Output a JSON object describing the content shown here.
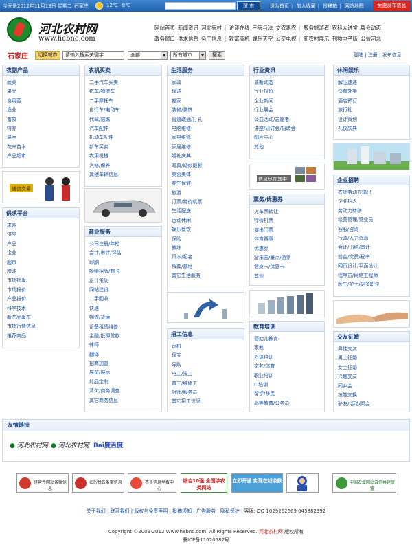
{
  "topbar": {
    "date": "今天是2012年11月13日 星期二",
    "city": "石家庄",
    "temperature": "12℃~0℃",
    "search_button": "搜 索",
    "links": [
      "设为首页",
      "加入收藏",
      "投稿箱",
      "网站地图"
    ],
    "free_publish": "免费发布信息"
  },
  "header": {
    "site_name": "河北农村网",
    "site_url": "www.hebnc.com",
    "nav_row1": [
      "网站首页",
      "新闻资讯",
      "河北农村",
      "|",
      "访谈在线",
      "三农与法",
      "支农惠农",
      "|",
      "服务旅游者",
      "农科大讲堂",
      "展会动态"
    ],
    "nav_row2": [
      "政务窗口",
      "供求信息",
      "务工信息",
      "|",
      "致富商机",
      "娱乐天空",
      "公交电视",
      "|",
      "新农村展示",
      "刊物电子版",
      "公益河北"
    ]
  },
  "citybar": {
    "city": "石家庄",
    "switch_label": "切换城市",
    "search_value": "请输入搜索关键字",
    "category_select": "全部",
    "city_select": "所有城市",
    "search_button": "搜索",
    "right_links": [
      "登陆",
      "注册",
      "发布信息"
    ]
  },
  "boxes": {
    "agri": {
      "title": "农副产品",
      "items": [
        "蔬菜",
        "果品",
        "食用菌",
        "渔业",
        "畜牧",
        "特养",
        "温室",
        "花卉苗木",
        "产品超市"
      ]
    },
    "machinery": {
      "title": "农机买卖",
      "items": [
        "二手汽车买卖",
        "挤车/物流车",
        "二手摩托车",
        "自行车/电动车",
        "代驾/陪练",
        "汽车配件",
        "机动车配件",
        "新车买卖",
        "农用机械",
        "汽修/保养",
        "其他车辆信息"
      ]
    },
    "life": {
      "title": "生活服务",
      "items": [
        "家政",
        "保洁",
        "搬家",
        "装修/装饰",
        "管道疏通/打孔",
        "电脑维修",
        "家电维修",
        "家居维修",
        "婚礼庆典",
        "写真/婚纱摄影",
        "美容美体",
        "养生保健",
        "旅游",
        "订票/特价机票",
        "生活配送",
        "运动休闲",
        "娱乐餐饮",
        "保险",
        "教练",
        "风水/起名",
        "殡葬/墓地",
        "其它生活服务"
      ]
    },
    "industry": {
      "title": "行业资讯",
      "items": [
        "最新动态",
        "行业报价",
        "企业新闻",
        "行业展会",
        "公益活动/志愿者",
        "讲座/研讨会/招聘会",
        "图片中心",
        "其他"
      ]
    },
    "leisure": {
      "title": "休闲娱乐",
      "items": [
        "解压速递",
        "快餐外卖",
        "酒店预订",
        "旅行社",
        "设计策划",
        "礼仪庆典"
      ]
    },
    "supply": {
      "title": "供求平台",
      "items": [
        "求购",
        "供应",
        "产品",
        "企业",
        "超市",
        "粮油",
        "市场批发",
        "市场报价",
        "产品报价",
        "科学技术",
        "新产品发布",
        "市场行情信息",
        "推荐商品"
      ]
    },
    "business": {
      "title": "商业服务",
      "items": [
        "公司注册/年检",
        "会计/审计/评估",
        "印刷",
        "喷绘招牌/制卡",
        "设计策划",
        "网站建设",
        "二手回收",
        "快递",
        "物流/货运",
        "设备租赁维修",
        "金融/抵押贷款",
        "律师",
        "翻译",
        "招商加盟",
        "展览/展示",
        "礼品定制",
        "清欠/商务调查",
        "其它商务信息"
      ]
    },
    "recruit": {
      "title": "招工信息",
      "items": [
        "司机",
        "保安",
        "导购",
        "电工/技工",
        "普工/维修工",
        "厨师/服务员",
        "其它招工信息"
      ]
    },
    "tickets": {
      "title": "票务/优惠券",
      "items": [
        "火车票转让",
        "特价机票",
        "演出门票",
        "体育赛事",
        "优惠券",
        "游乐园/景点/游票",
        "健身卡/优惠卡",
        "其他"
      ]
    },
    "jobs": {
      "title": "企业招聘",
      "items": [
        "农场劳动力输出",
        "企业招人",
        "劳动力转移",
        "经营管理/营业员",
        "客服/咨询",
        "行政/人力资源",
        "会计/出纳/审计",
        "前台/文员/秘书",
        "网页设计/平面设计",
        "程序员/网络工程师",
        "医生/护士/更多职位"
      ]
    },
    "education": {
      "title": "教育培训",
      "items": [
        "婴幼儿教育",
        "家教",
        "外语培训",
        "文艺/体育",
        "职业培训",
        "IT培训",
        "留学/移民",
        "高等教育/公务员"
      ]
    },
    "dating": {
      "title": "交友征婚",
      "items": [
        "异性交友",
        "男士征婚",
        "女士征婚",
        "兴趣交友",
        "同乡会",
        "技能交换",
        "驴友/活动/聚会"
      ]
    }
  },
  "picture_captions": {
    "machinery_ad": "",
    "tickets_ad": "信息尽在其中",
    "agri_ad": "诚信交易"
  },
  "friends": {
    "title": "友情链接",
    "logos": [
      "河北农村网",
      "河北农村网",
      "Bai度百度"
    ]
  },
  "certs": [
    "经营性网站备案信息",
    "ICP/税名备案信息",
    "不良信息举报中心",
    "综合10强 全国涉农类网站",
    "立即开通 实现在线收款",
    "",
    "中国农业网站诚信共建联盟"
  ],
  "footer": {
    "links": [
      "关于我们",
      "联系我们",
      "版权与免责声明",
      "投稿须知",
      "广告服务",
      "隐私保护",
      "客服: QQ 1029262669 643882992"
    ],
    "copyright_prefix": "Copyright ©2009-2012 Www.hebnc.com. All Rights Reserved. ",
    "copyright_site": "河北农村网",
    "copyright_suffix": " 版权所有",
    "icp": "冀ICP备11020587号"
  },
  "colors": {
    "topbar": "#2a6fc0",
    "accent_red": "#c81e1e",
    "link_blue": "#1a4f9a",
    "heading_blue": "#163b74"
  }
}
